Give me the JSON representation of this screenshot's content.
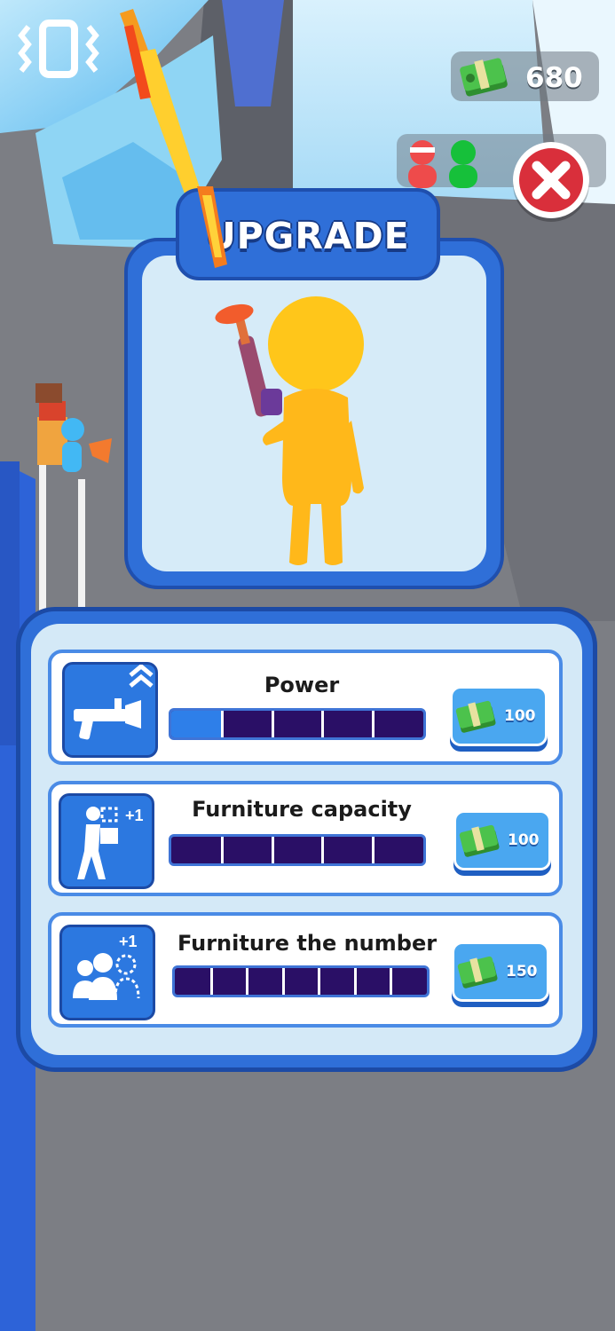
{
  "hud": {
    "money": "680",
    "icons": [
      "vibration-icon",
      "cash-icon",
      "player-red-icon",
      "player-green-icon",
      "close-icon"
    ]
  },
  "upgrade": {
    "title": "UPGRADE"
  },
  "upgrades": [
    {
      "label": "Power",
      "price": "100",
      "level_fraction": 0.2,
      "segments": 5,
      "icon": "plunger-gun-icon"
    },
    {
      "label": "Furniture capacity",
      "price": "100",
      "level_fraction": 0.0,
      "segments": 5,
      "icon": "carry-box-icon"
    },
    {
      "label": "Furniture the number",
      "price": "150",
      "level_fraction": 0.0,
      "segments": 7,
      "icon": "crowd-plus-icon"
    }
  ],
  "colors": {
    "panel_blue": "#2f6fd8",
    "bar_empty": "#2a0f66",
    "bar_filled": "#2e7fe9",
    "close_red": "#d92f3b"
  }
}
